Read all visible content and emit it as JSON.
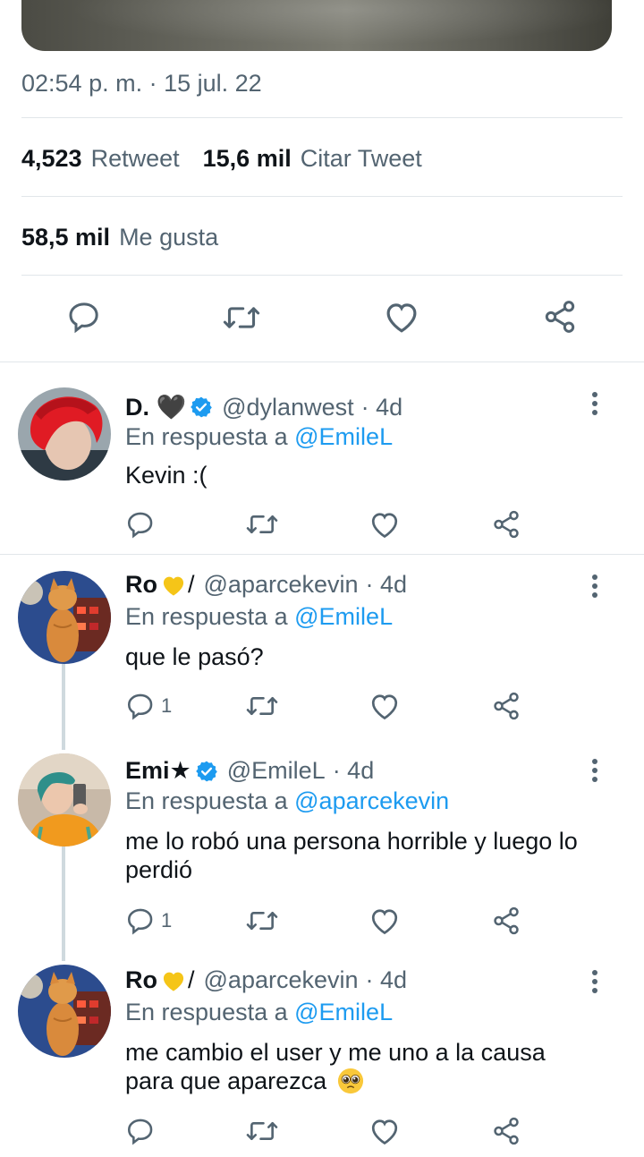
{
  "main_tweet": {
    "timestamp": "02:54 p. m. · 15 jul. 22",
    "retweets_count": "4,523",
    "retweets_label": "Retweet",
    "quotes_count": "15,6 mil",
    "quotes_label": "Citar Tweet",
    "likes_count": "58,5 mil",
    "likes_label": "Me gusta"
  },
  "icons": {
    "reply": "reply-icon",
    "retweet": "retweet-icon",
    "like": "heart-icon",
    "share": "share-icon",
    "more": "more-vertical-icon",
    "verified": "verified-badge-icon"
  },
  "colors": {
    "accent": "#1d9bf0",
    "muted": "#536471",
    "verified": "#1d9bf0",
    "heart_emoji": "#f5c518"
  },
  "replies": [
    {
      "display_name": "D. 🖤",
      "handle": "@dylanwest",
      "time": "· 4d",
      "reply_prefix": "En respuesta a",
      "reply_to": "@EmileL",
      "text": "Kevin :(",
      "reply_count": ""
    },
    {
      "display_name": "Ro",
      "name_suffix": "/",
      "handle": "@aparcekevin",
      "time": "· 4d",
      "reply_prefix": "En respuesta a",
      "reply_to": "@EmileL",
      "text": "que le pasó?",
      "reply_count": "1"
    },
    {
      "display_name": "Emi★",
      "handle": "@EmileL",
      "time": "· 4d",
      "reply_prefix": "En respuesta a",
      "reply_to": "@aparcekevin",
      "text": "me lo robó una persona horrible y luego lo perdió",
      "reply_count": "1"
    },
    {
      "display_name": "Ro",
      "name_suffix": "/",
      "handle": "@aparcekevin",
      "time": "· 4d",
      "reply_prefix": "En respuesta a",
      "reply_to": "@EmileL",
      "text": "me cambio el user y me uno a la causa para que aparezca",
      "reply_count": ""
    }
  ]
}
